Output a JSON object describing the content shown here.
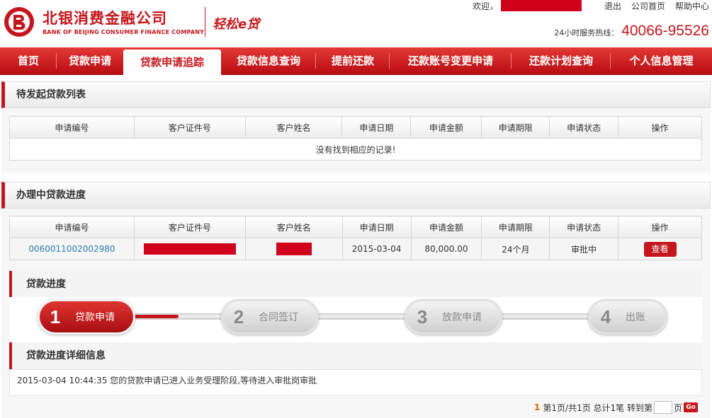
{
  "brand": {
    "name_cn": "北银消费金融公司",
    "name_en": "BANK OF BEIJING CONSUMER FINANCE COMPANY",
    "product": "轻松e贷",
    "primary_color": "#c4161c"
  },
  "top_links": {
    "welcome": "欢迎，",
    "logout": "退出",
    "home": "公司首页",
    "help": "帮助中心"
  },
  "hotline": {
    "label": "24小时服务热线：",
    "number": "40066-95526"
  },
  "nav": {
    "items": [
      {
        "label": "首页"
      },
      {
        "label": "贷款申请"
      },
      {
        "label": "贷款申请追踪"
      },
      {
        "label": "贷款信息查询"
      },
      {
        "label": "提前还款"
      },
      {
        "label": "还款账号变更申请"
      },
      {
        "label": "还款计划查询"
      },
      {
        "label": "个人信息管理"
      }
    ],
    "active_index": 2
  },
  "pending": {
    "title": "待发起贷款列表",
    "columns": [
      "申请编号",
      "客户证件号",
      "客户姓名",
      "申请日期",
      "申请金额",
      "申请期限",
      "申请状态",
      "操作"
    ],
    "empty_message": "没有找到相应的记录!"
  },
  "processing": {
    "title": "办理中贷款进度",
    "columns": [
      "申请编号",
      "客户证件号",
      "客户姓名",
      "申请日期",
      "申请金额",
      "申请期限",
      "申请状态",
      "操作"
    ],
    "row": {
      "app_no": "0060011002002980",
      "date": "2015-03-04",
      "amount": "80,000.00",
      "term": "24个月",
      "status": "审批中",
      "action": "查看"
    }
  },
  "progress": {
    "title": "贷款进度",
    "steps": [
      {
        "num": "1",
        "label": "贷款申请"
      },
      {
        "num": "2",
        "label": "合同签订"
      },
      {
        "num": "3",
        "label": "放款申请"
      },
      {
        "num": "4",
        "label": "出账"
      }
    ],
    "current_step": 1
  },
  "detail": {
    "title": "贷款进度详细信息",
    "text": "2015-03-04 10:44:35 您的贷款申请已进入业务受理阶段,等待进入审批岗审批"
  },
  "pager": {
    "current": "1",
    "summary": "第1页/共1页 总计1笔 转到第",
    "page_suffix": "页",
    "go": "Go"
  }
}
